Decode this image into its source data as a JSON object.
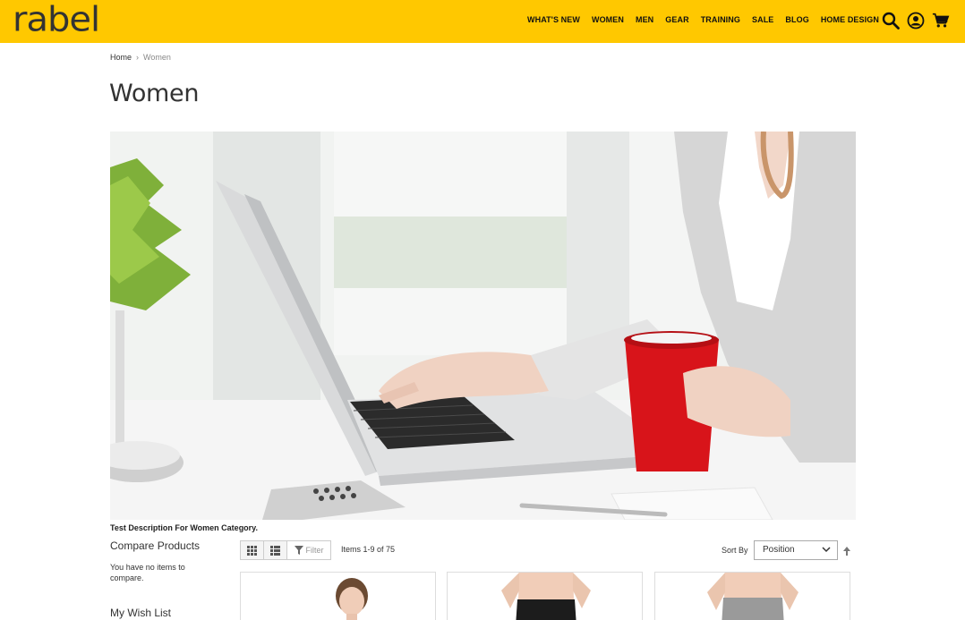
{
  "brand": {
    "logo_text": "rabel",
    "accent": "#ffc800"
  },
  "nav": {
    "items": [
      "WHAT'S NEW",
      "WOMEN",
      "MEN",
      "GEAR",
      "TRAINING",
      "SALE",
      "BLOG",
      "HOME DESIGN"
    ]
  },
  "header_icons": [
    "search-icon",
    "account-icon",
    "cart-icon"
  ],
  "breadcrumb": {
    "home": "Home",
    "separator": "›",
    "current": "Women"
  },
  "page": {
    "title": "Women",
    "description": "Test Description For Women Category."
  },
  "sidebar": {
    "compare_title": "Compare Products",
    "compare_text": "You have no items to compare.",
    "wishlist_title": "My Wish List"
  },
  "toolbar": {
    "modes": [
      "grid-icon",
      "list-icon"
    ],
    "filter_label": "Filter",
    "items_count": "Items 1-9 of 75",
    "sort_by_label": "Sort By",
    "sort_value": "Position"
  }
}
